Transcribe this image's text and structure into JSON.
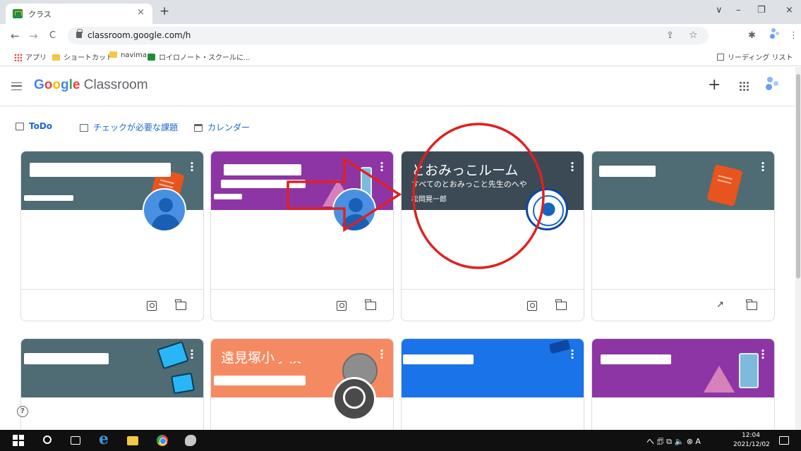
{
  "browser": {
    "tab_title": "クラス",
    "tab_close": "×",
    "new_tab": "+",
    "window_controls": [
      "∨",
      "–",
      "❐",
      "×"
    ],
    "nav": {
      "back": "←",
      "forward": "→",
      "reload": "C"
    },
    "url": "classroom.google.com/h",
    "toolbar_icons": [
      "⇪",
      "☆",
      "✱",
      "⋮"
    ],
    "bookmarks": [
      {
        "label": "アプリ",
        "icon": "apps-grid-icon"
      },
      {
        "label": "ショートカット",
        "icon": "folder-icon"
      },
      {
        "label": "navima",
        "icon": "folder-icon"
      },
      {
        "label": "ロイロノート・スクールに...",
        "icon": "classroom-favicon-icon"
      }
    ],
    "reading_list": "リーディング リスト"
  },
  "app": {
    "logo_google": [
      "G",
      "o",
      "o",
      "g",
      "l",
      "e"
    ],
    "logo_product": "Classroom",
    "plus": "+",
    "filters": [
      {
        "label": "ToDo",
        "icon": "todo-icon"
      },
      {
        "label": "チェックが必要な課題",
        "icon": "review-icon"
      },
      {
        "label": "カレンダー",
        "icon": "calendar-icon"
      }
    ],
    "help": "?"
  },
  "cards": [
    {
      "title": "",
      "section": "",
      "teacher": "",
      "header_color": "#4f6b73",
      "footer_icons": [
        "portfolio-icon",
        "folder-icon"
      ],
      "redacted": true
    },
    {
      "title": "",
      "section": "",
      "teacher": "",
      "header_color": "#8e35a6",
      "footer_icons": [
        "portfolio-icon",
        "folder-icon"
      ],
      "redacted": true
    },
    {
      "title": "とおみっこルーム",
      "section": "すべてのとおみっこと先生のへや",
      "teacher": "松岡晃一郎",
      "header_color": "#3b4a55",
      "footer_icons": [
        "portfolio-icon",
        "folder-icon"
      ],
      "redacted": false
    },
    {
      "title": "",
      "section": "",
      "teacher": "",
      "header_color": "#4f6b73",
      "footer_icons": [
        "trending-icon",
        "folder-icon"
      ],
      "redacted": true
    },
    {
      "title": "",
      "section": "",
      "teacher": "",
      "header_color": "#4f6b73",
      "redacted": true
    },
    {
      "title": "遠見塚小学校",
      "section": "",
      "teacher": "",
      "header_color": "#f58a62",
      "redacted": true
    },
    {
      "title": "",
      "section": "",
      "teacher": "",
      "header_color": "#1a73e8",
      "redacted": true
    },
    {
      "title": "",
      "section": "",
      "teacher": "",
      "header_color": "#8e35a6",
      "redacted": true
    }
  ],
  "annotation": {
    "color": "#e02020"
  },
  "taskbar": {
    "tray_icons": "へ 🗊 ⧉ 🔈 ⊗ A",
    "time": "12:04",
    "date": "2021/12/02"
  }
}
